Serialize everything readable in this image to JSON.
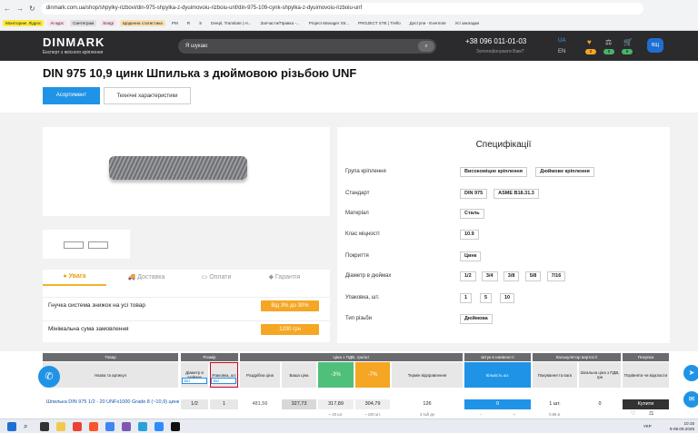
{
  "browser": {
    "url": "dinmark.com.ua/shop/shpylky-rizbovi/din-975-shpylka-z-dyuimovoiu-rizboiu-unf/din-975-109-cynk-shpylka-z-dyuimovoiu-rizboiu-unf",
    "nav_icons": [
      "←",
      "→",
      "↻",
      "ⓘ"
    ],
    "bookmarks": [
      {
        "label": "Моніторинг Лідрос",
        "style": "y"
      },
      {
        "label": "AI курс",
        "style": "p"
      },
      {
        "label": "Синтеграм",
        "style": "g"
      },
      {
        "label": "Soogi",
        "style": "p"
      },
      {
        "label": "Щоденна статистика",
        "style": "o"
      },
      {
        "label": "PM",
        "style": "plain"
      },
      {
        "label": "R",
        "style": "plain"
      },
      {
        "label": "S",
        "style": "plain"
      },
      {
        "label": "Deepl, Translate | H...",
        "style": "plain"
      },
      {
        "label": "Запчасти/Правка -...",
        "style": "plain"
      },
      {
        "label": "Project Manager Str...",
        "style": "plain"
      },
      {
        "label": "PROJECT STE | Trello",
        "style": "plain"
      },
      {
        "label": "Доступи - Evernote",
        "style": "plain"
      },
      {
        "label": "Усі закладки",
        "style": "plain"
      }
    ]
  },
  "header": {
    "logo": "DINMARK",
    "tagline": "Експерт з якісного кріплення",
    "search_placeholder": "Я шукаю",
    "phone": "+38 096 011-01-03",
    "callback": "Зателефонувати Вам?",
    "lang_active": "UA",
    "lang_other": "EN",
    "counters": [
      "2",
      "0",
      "0"
    ],
    "avatar": "ВЩ"
  },
  "product": {
    "title": "DIN 975 10,9 цинк Шпилька з дюймовою різьбою UNF",
    "tabs": [
      "Асортимент",
      "Технічні характеристики"
    ]
  },
  "info_tabs": [
    "Увага",
    "Доставка",
    "Оплати",
    "Гарантія"
  ],
  "info_rows": [
    {
      "label": "Гнучка система знижок на усі товар",
      "badge": "Від 3% до 30%"
    },
    {
      "label": "Мінімальна сума замовлення",
      "badge": "1200 грн"
    }
  ],
  "spec": {
    "title": "Специфікації",
    "rows": [
      {
        "label": "Група кріплення",
        "values": [
          "Високоміцне кріплення",
          "Дюймове кріплення"
        ]
      },
      {
        "label": "Стандарт",
        "values": [
          "DIN 975",
          "ASME B18.31.3"
        ]
      },
      {
        "label": "Матеріал",
        "values": [
          "Сталь"
        ]
      },
      {
        "label": "Клас міцності",
        "values": [
          "10.9"
        ]
      },
      {
        "label": "Покриття",
        "values": [
          "Цинк"
        ]
      },
      {
        "label": "Діаметр в дюймах",
        "values": [
          "1/2",
          "3/4",
          "3/8",
          "5/8",
          "7/16"
        ]
      },
      {
        "label": "Упаковка, шт.",
        "values": [
          "1",
          "5",
          "10"
        ]
      },
      {
        "label": "Тип різьби",
        "values": [
          "Дюймова"
        ]
      }
    ]
  },
  "table": {
    "groups": [
      "Товар",
      "Розмір",
      "Ціна з ПДВ, грн/шт",
      "Штук в наявності",
      "Калькулятор вартості",
      "Покупка"
    ],
    "cols": [
      "Назва та артикул",
      "Діаметр в дюймах",
      "Упаковка, шт.",
      "Роздрібна ціна",
      "Ваша ціна",
      "-3%",
      "-7%",
      "Термін відправлення",
      "Кількість шт.",
      "Пакування та вага",
      "Загальна ціна з ПДВ, грн",
      "Порівняти чи відкласти"
    ],
    "filter_labels": [
      "Всі",
      "Всі"
    ],
    "row": {
      "name": "Шпилька DIN 975 1/2 - 20 UNFx1000 Grade 8 (~10,9) цинк",
      "diameter": "1/2",
      "pack": "1",
      "retail": "481,56",
      "your_price": "327,73",
      "p3": "317,89",
      "p7": "304,79",
      "sub_p3": "~ 20 шт.",
      "sub_p7": "~ 100 шт.",
      "stock": "126",
      "stock_sub": "3 sufi дн",
      "qty": "0",
      "qty_minus": "−",
      "qty_plus": "+",
      "pack_text": "1 шт.",
      "weight": "0.86 кг",
      "total": "0",
      "buy": "Купити"
    }
  },
  "taskbar": {
    "lang": "УКР",
    "time": "10:15",
    "date": "9-09.09.2025"
  }
}
